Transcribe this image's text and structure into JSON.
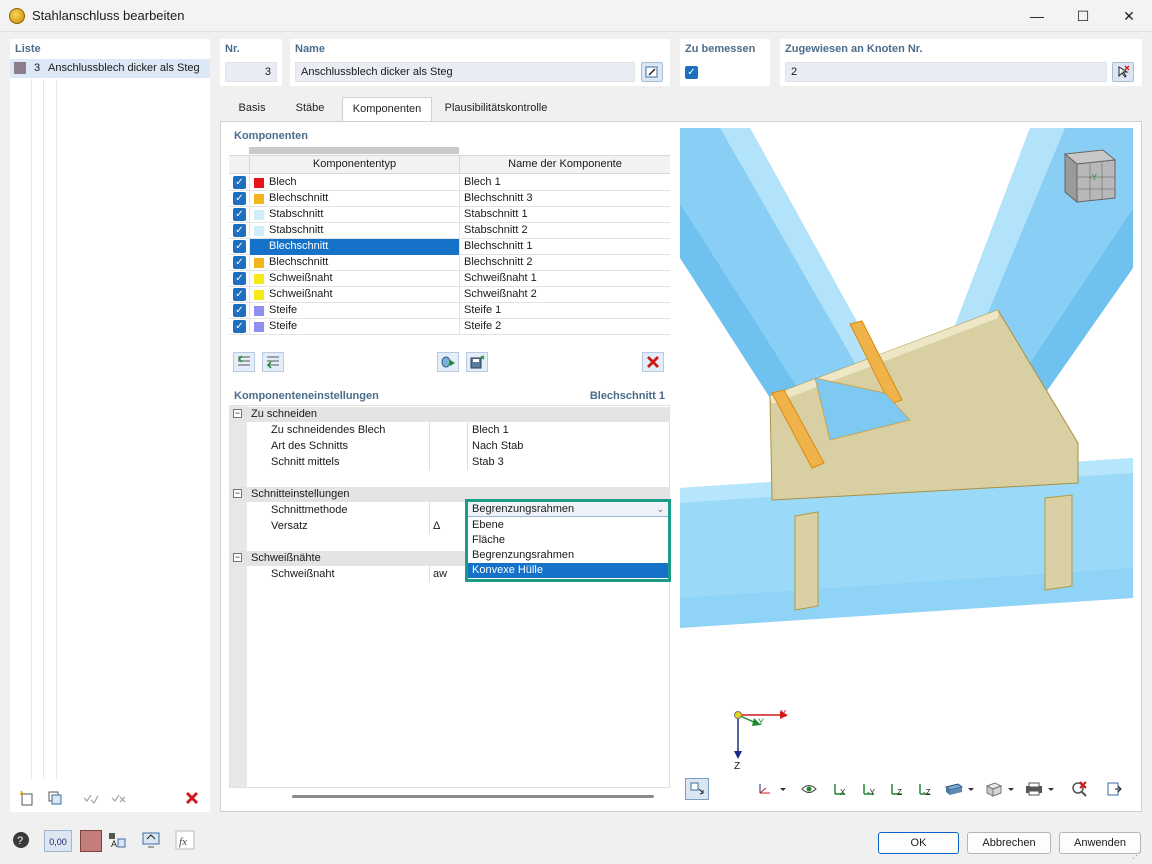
{
  "window": {
    "title": "Stahlanschluss bearbeiten",
    "minimize": "—",
    "maximize": "☐",
    "close": "✕"
  },
  "list": {
    "header": "Liste",
    "items": [
      {
        "number": "3",
        "label": "Anschlussblech dicker als Steg",
        "color": "#8b7d8c"
      }
    ]
  },
  "fields": {
    "nr_label": "Nr.",
    "nr_value": "3",
    "name_label": "Name",
    "name_value": "Anschlussblech dicker als Steg",
    "design_label": "Zu bemessen",
    "nodes_label": "Zugewiesen an Knoten Nr.",
    "nodes_value": "2"
  },
  "tabs": [
    "Basis",
    "Stäbe",
    "Komponenten",
    "Plausibilitätskontrolle"
  ],
  "components": {
    "header": "Komponenten",
    "col_type": "Komponententyp",
    "col_name": "Name der Komponente",
    "rows": [
      {
        "type": "Blech",
        "name": "Blech 1",
        "color": "#e8141c"
      },
      {
        "type": "Blechschnitt",
        "name": "Blechschnitt 3",
        "color": "#f2b51c"
      },
      {
        "type": "Stabschnitt",
        "name": "Stabschnitt 1",
        "color": "#cfeef9"
      },
      {
        "type": "Stabschnitt",
        "name": "Stabschnitt 2",
        "color": "#cfeef9"
      },
      {
        "type": "Blechschnitt",
        "name": "Blechschnitt 1",
        "color": "#b3a33c"
      },
      {
        "type": "Blechschnitt",
        "name": "Blechschnitt 2",
        "color": "#f2b51c"
      },
      {
        "type": "Schweißnaht",
        "name": "Schweißnaht 1",
        "color": "#f7ea14"
      },
      {
        "type": "Schweißnaht",
        "name": "Schweißnaht 2",
        "color": "#f7ea14"
      },
      {
        "type": "Steife",
        "name": "Steife 1",
        "color": "#8f8fef"
      },
      {
        "type": "Steife",
        "name": "Steife 2",
        "color": "#8f8fef"
      }
    ]
  },
  "settings": {
    "header": "Komponenteneinstellungen",
    "current": "Blechschnitt 1",
    "groups": [
      {
        "title": "Zu schneiden",
        "props": [
          {
            "label": "Zu schneidendes Blech",
            "symbol": "",
            "value": "Blech 1"
          },
          {
            "label": "Art des Schnitts",
            "symbol": "",
            "value": "Nach Stab"
          },
          {
            "label": "Schnitt mittels",
            "symbol": "",
            "value": "Stab 3"
          }
        ]
      },
      {
        "title": "Schnitteinstellungen",
        "props": [
          {
            "label": "Schnittmethode",
            "symbol": "",
            "value": ""
          },
          {
            "label": "Versatz",
            "symbol": "Δ",
            "value": ""
          }
        ]
      },
      {
        "title": "Schweißnähte",
        "props": [
          {
            "label": "Schweißnaht",
            "symbol": "aw",
            "value": ""
          }
        ]
      }
    ],
    "dropdown": {
      "selected": "Begrenzungsrahmen",
      "options": [
        "Ebene",
        "Fläche",
        "Begrenzungsrahmen",
        "Konvexe Hülle"
      ],
      "highlighted": "Konvexe Hülle"
    }
  },
  "viewport": {
    "axis_x": "X",
    "axis_y": "Y",
    "axis_z": "Z",
    "cube_label": "-Y"
  },
  "buttons": {
    "ok": "OK",
    "cancel": "Abbrechen",
    "apply": "Anwenden"
  },
  "status": {
    "decimal": "0,00",
    "accent": "#1f6fbf",
    "delete": "#d01a1a"
  }
}
